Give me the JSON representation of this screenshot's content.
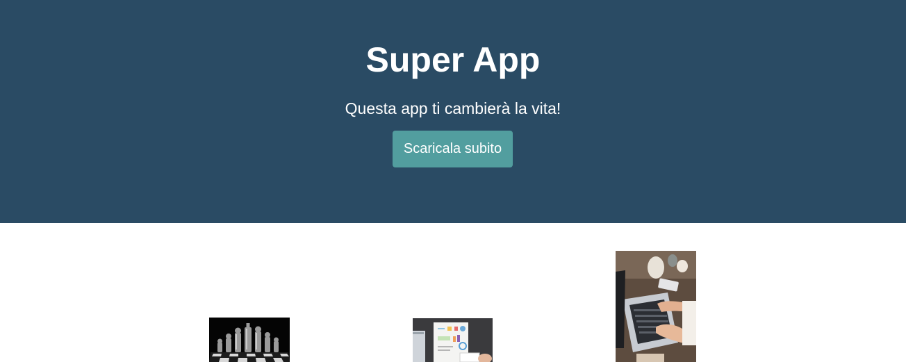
{
  "hero": {
    "title": "Super App",
    "subtitle": "Questa app ti cambierà la vita!",
    "cta_label": "Scaricala subito"
  },
  "colors": {
    "hero_background": "#2a4b64",
    "cta_background": "#529e9f",
    "page_background": "#ffffff"
  },
  "gallery": [
    {
      "subject": "chess pieces on board"
    },
    {
      "subject": "printed charts report on desk"
    },
    {
      "subject": "hands typing on laptop"
    }
  ]
}
